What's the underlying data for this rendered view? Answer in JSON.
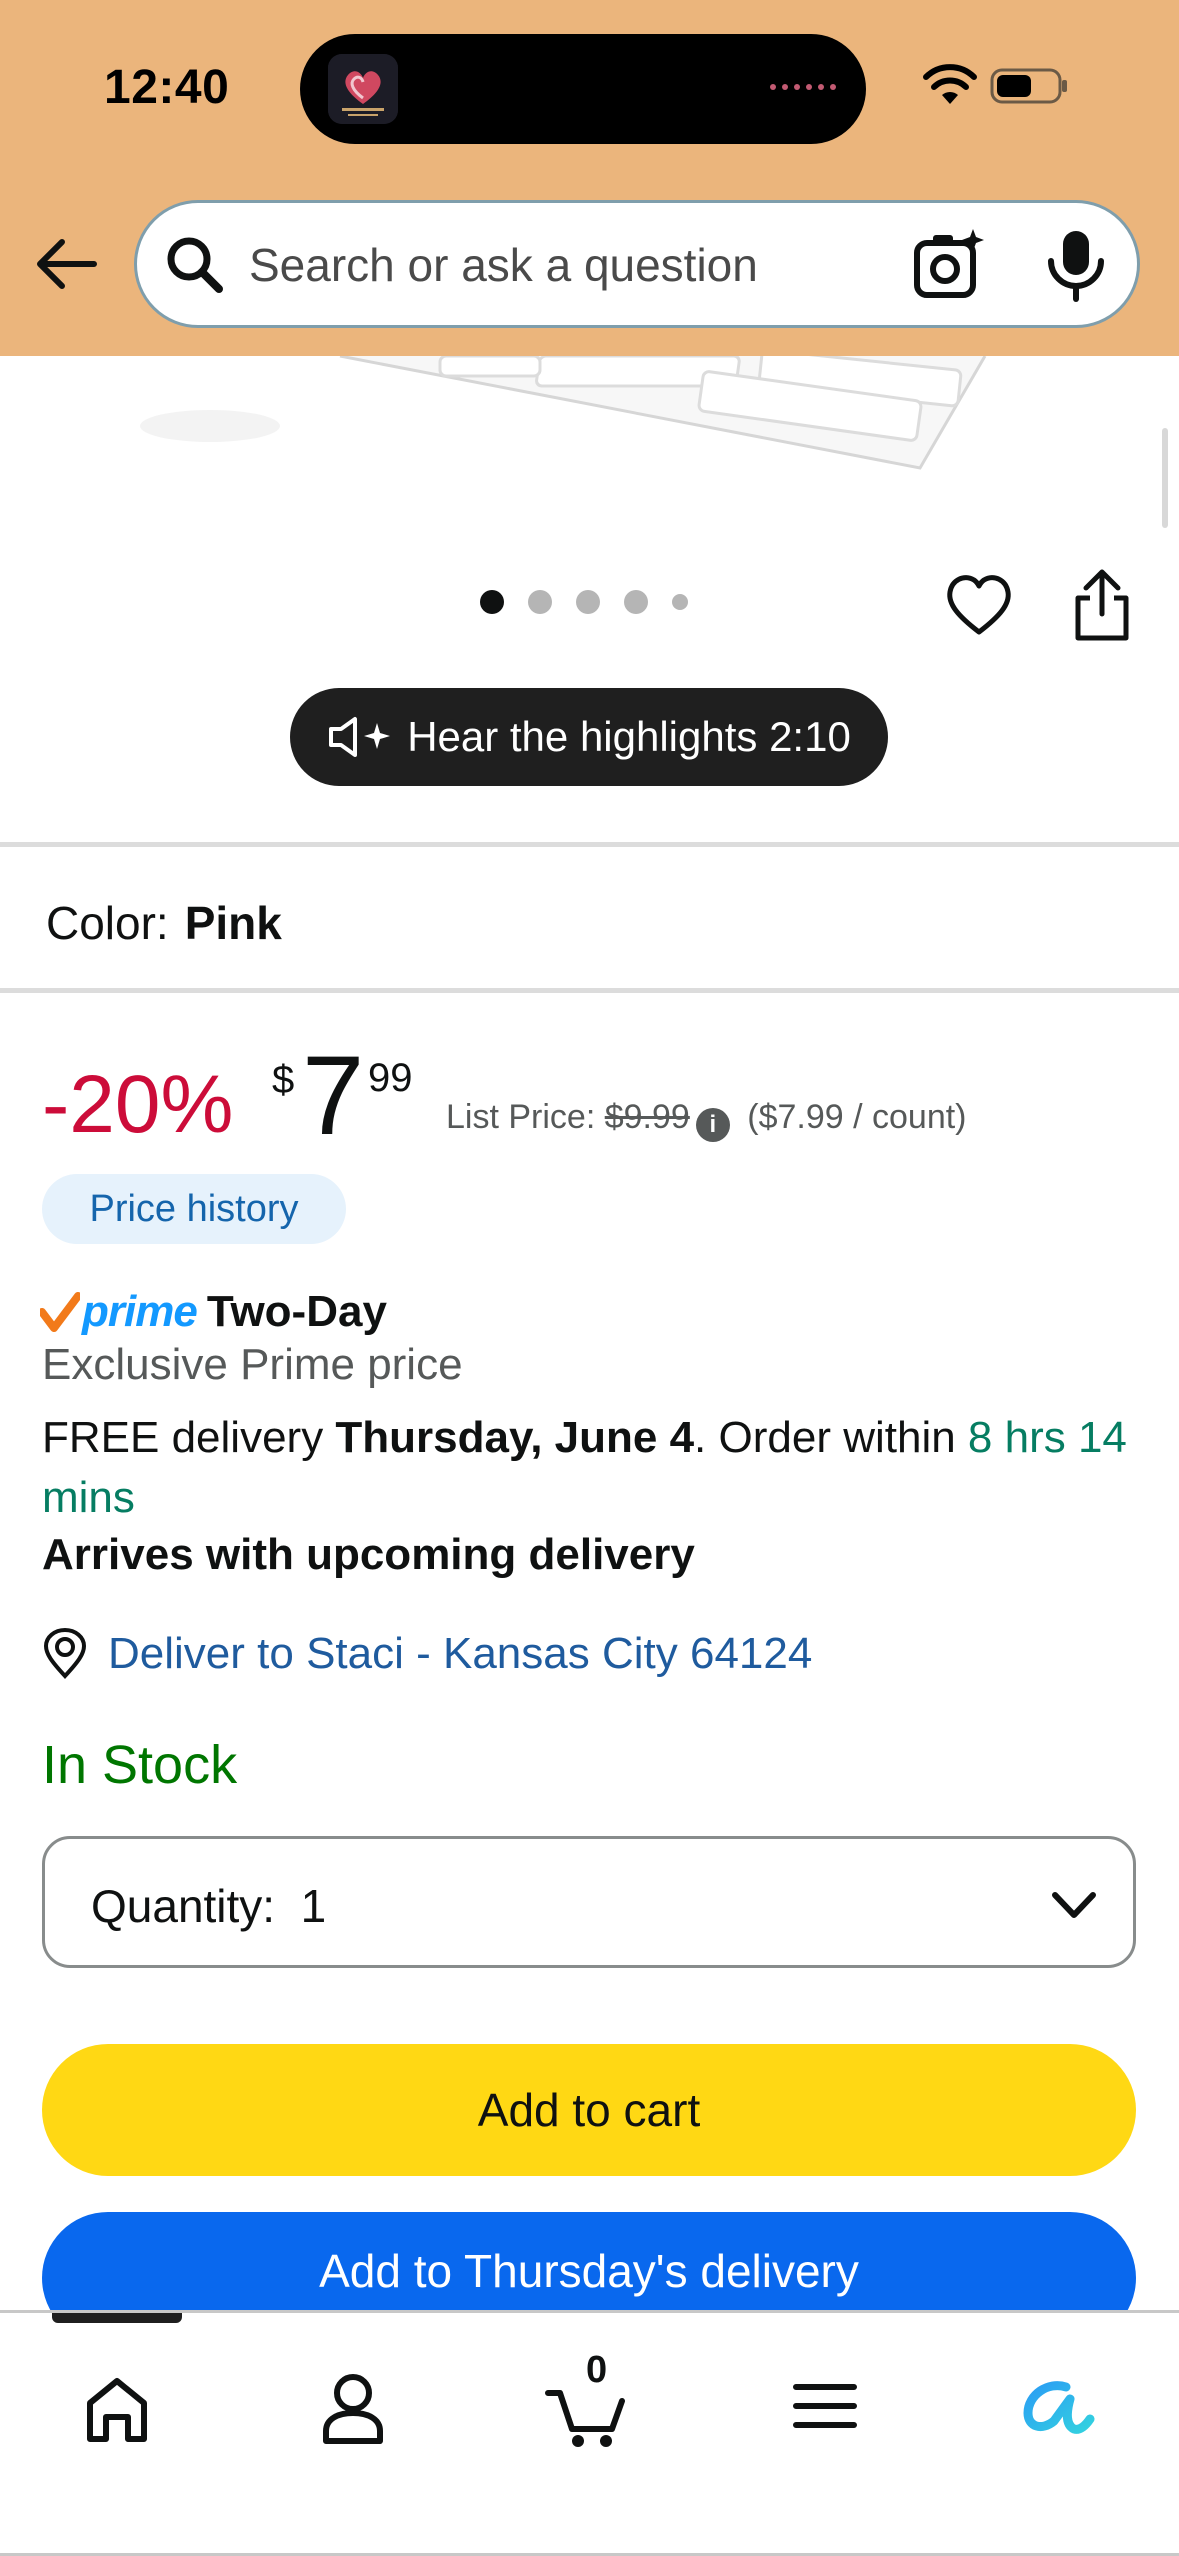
{
  "status_bar": {
    "time": "12:40",
    "island_app_icon": "relationship-advice-app-icon"
  },
  "header": {
    "background_color": "#ebb57c",
    "search": {
      "placeholder": "Search or ask a question"
    },
    "icons": [
      "back-arrow-icon",
      "search-icon",
      "camera-lens-icon",
      "microphone-icon"
    ]
  },
  "gallery": {
    "image_count": 5,
    "active_index": 0,
    "hear_highlights_label": "Hear the highlights 2:10"
  },
  "variation": {
    "label": "Color:",
    "value": "Pink"
  },
  "price": {
    "discount": "-20%",
    "currency_symbol": "$",
    "whole": "7",
    "fraction": "99",
    "list_price_label": "List Price:",
    "list_price_value": "$9.99",
    "unit_price": "($7.99 / count)",
    "price_history_label": "Price history",
    "discount_color": "#cc0c39"
  },
  "prime": {
    "prime_word": "prime",
    "two_day": "Two-Day",
    "exclusive": "Exclusive Prime price"
  },
  "delivery": {
    "prefix": "FREE delivery ",
    "date": "Thursday, June 4",
    "order_within_prefix": ". Order within ",
    "countdown": "8 hrs 14 mins",
    "arrives": "Arrives with upcoming delivery",
    "deliver_to": "Deliver to Staci - Kansas City 64124"
  },
  "stock": {
    "status": "In Stock",
    "color": "#007600"
  },
  "quantity": {
    "label": "Quantity:",
    "value": "1"
  },
  "buttons": {
    "add_to_cart": "Add to cart",
    "add_to_delivery": "Add to Thursday's delivery"
  },
  "bottom_nav": {
    "cart_count": "0",
    "items": [
      "home-icon",
      "account-icon",
      "cart-icon",
      "menu-icon",
      "rufus-ai-icon"
    ]
  }
}
